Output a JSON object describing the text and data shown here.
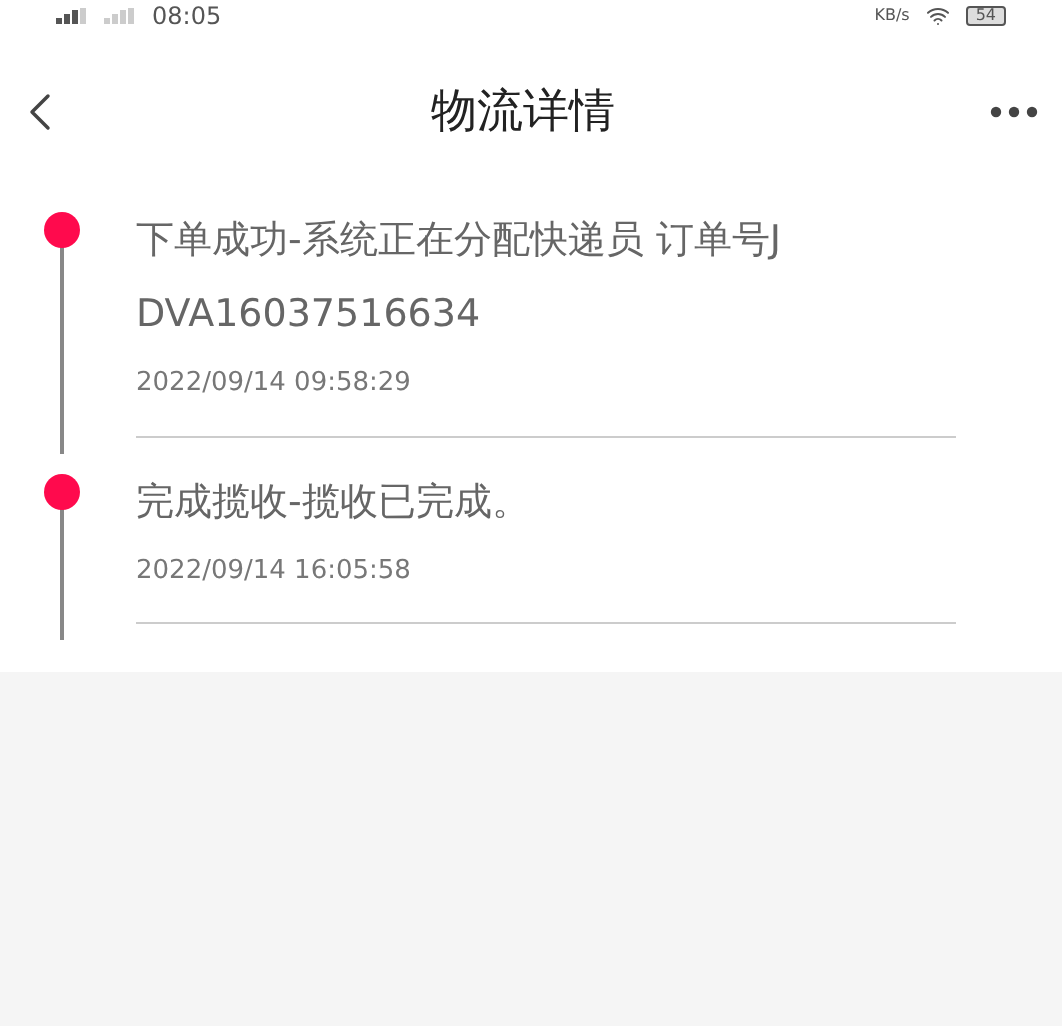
{
  "status_bar": {
    "time": "08:05",
    "speed_unit": "KB/s",
    "battery": "54"
  },
  "header": {
    "title": "物流详情"
  },
  "timeline": [
    {
      "text": "下单成功-系统正在分配快递员 订单号JDVA16037516634",
      "time": "2022/09/14 09:58:29"
    },
    {
      "text": "完成揽收-揽收已完成。",
      "time": "2022/09/14 16:05:58"
    }
  ]
}
